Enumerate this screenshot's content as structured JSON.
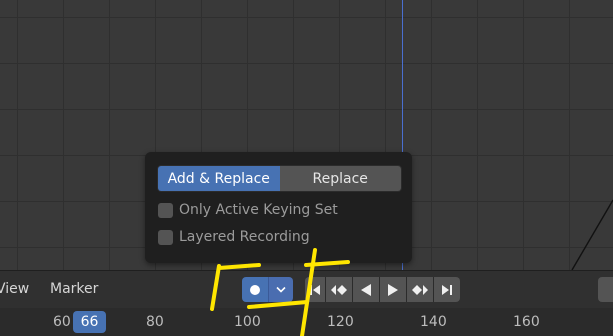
{
  "popup": {
    "mode_options": [
      "Add & Replace",
      "Replace"
    ],
    "selected_mode": "Add & Replace",
    "only_active_keying_set_label": "Only Active Keying Set",
    "only_active_keying_set_checked": false,
    "layered_recording_label": "Layered Recording",
    "layered_recording_checked": false
  },
  "header": {
    "menu_view": "View",
    "menu_marker": "Marker"
  },
  "icons": {
    "record": "record-dot-icon",
    "keying_menu": "chevron-down-icon",
    "jump_start": "jump-to-start-icon",
    "prev_keyframe": "previous-keyframe-icon",
    "play_reverse": "play-reverse-icon",
    "play": "play-icon",
    "next_keyframe": "next-keyframe-icon",
    "jump_end": "jump-to-end-icon"
  },
  "ruler": {
    "ticks": [
      "60",
      "80",
      "100",
      "120",
      "140",
      "160"
    ],
    "current_frame": "66"
  },
  "colors": {
    "accent": "#4772b3",
    "annotation": "#ffe600",
    "background": "#393939"
  }
}
